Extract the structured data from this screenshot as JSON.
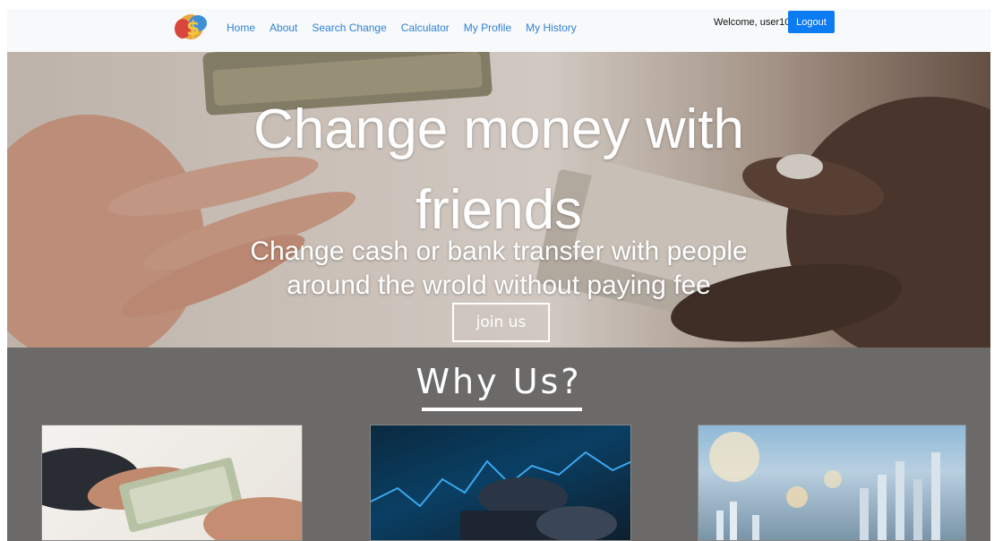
{
  "navbar": {
    "links": [
      "Home",
      "About",
      "Search Change",
      "Calculator",
      "My Profile",
      "My History"
    ],
    "welcome_text": "Welcome, user10",
    "logout_label": "Logout"
  },
  "hero": {
    "title_line1": "Change money with",
    "title_line2": "friends",
    "subtitle_line1": "Change cash or bank transfer with people",
    "subtitle_line2": "around the wrold without paying fee",
    "join_label": "join us"
  },
  "why": {
    "title": "Why Us?"
  },
  "colors": {
    "nav_link": "#2f82d8",
    "logout_bg": "#0d7bf2",
    "section_bg": "#6b6a69"
  }
}
